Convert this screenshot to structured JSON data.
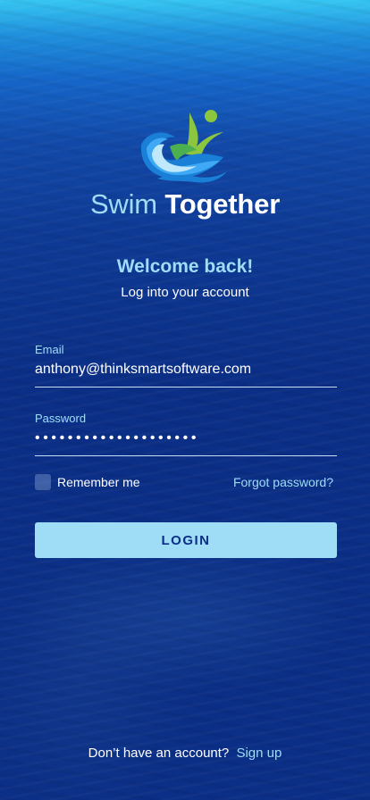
{
  "brand": {
    "name_part1": "Swim",
    "name_part2": "Together",
    "logo_icon": "swimmer-wave-icon"
  },
  "header": {
    "welcome": "Welcome back!",
    "subtitle": "Log into your account"
  },
  "form": {
    "email": {
      "label": "Email",
      "value": "anthony@thinksmartsoftware.com"
    },
    "password": {
      "label": "Password",
      "masked_value": "••••••••••••••••••••"
    },
    "remember_me": {
      "label": "Remember me",
      "checked": false
    },
    "forgot_password": "Forgot password?",
    "login_button": "LOGIN"
  },
  "footer": {
    "prompt": "Don’t have an account?",
    "signup_link": "Sign up"
  },
  "colors": {
    "accent": "#9fdcf6",
    "background": "#0b2f86",
    "top_gradient": "#36c6f2",
    "logo_green": "#8cc63f",
    "logo_blue": "#1a7fd6"
  }
}
